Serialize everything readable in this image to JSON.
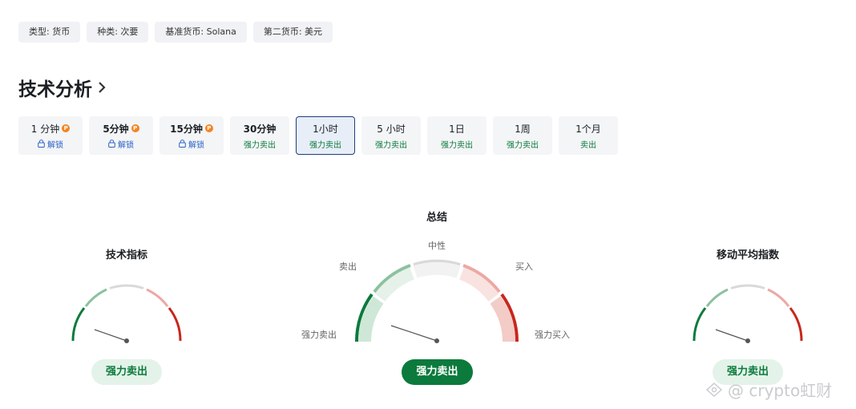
{
  "tags": [
    "类型: 货币",
    "种类: 次要",
    "基准货币: Solana",
    "第二货币: 美元"
  ],
  "section_title": "技术分析",
  "timeframes": [
    {
      "label": "1 分钟",
      "status": "解锁",
      "locked": true
    },
    {
      "label": "5分钟",
      "status": "解锁",
      "locked": true
    },
    {
      "label": "15分钟",
      "status": "解锁",
      "locked": true
    },
    {
      "label": "30分钟",
      "status": "强力卖出",
      "locked": false
    },
    {
      "label": "1小时",
      "status": "强力卖出",
      "locked": false,
      "active": true
    },
    {
      "label": "5 小时",
      "status": "强力卖出",
      "locked": false
    },
    {
      "label": "1日",
      "status": "强力卖出",
      "locked": false
    },
    {
      "label": "1周",
      "status": "强力卖出",
      "locked": false
    },
    {
      "label": "1个月",
      "status": "卖出",
      "locked": false
    }
  ],
  "pro_badge": "P",
  "gauges": {
    "indicators": {
      "title": "技术指标",
      "result": "强力卖出"
    },
    "summary": {
      "title": "总结",
      "result": "强力卖出",
      "labels": {
        "strong_sell": "强力卖出",
        "sell": "卖出",
        "neutral": "中性",
        "buy": "买入",
        "strong_buy": "强力买入"
      }
    },
    "moving_averages": {
      "title": "移动平均指数",
      "result": "强力卖出"
    }
  },
  "watermark": "@ crypto虹财",
  "colors": {
    "strong_sell": "#0b7a3c",
    "sell": "#8cc19f",
    "neutral": "#d9d9d9",
    "buy": "#eca8a3",
    "strong_buy": "#c8261c",
    "active_border": "#1e3f7a"
  }
}
